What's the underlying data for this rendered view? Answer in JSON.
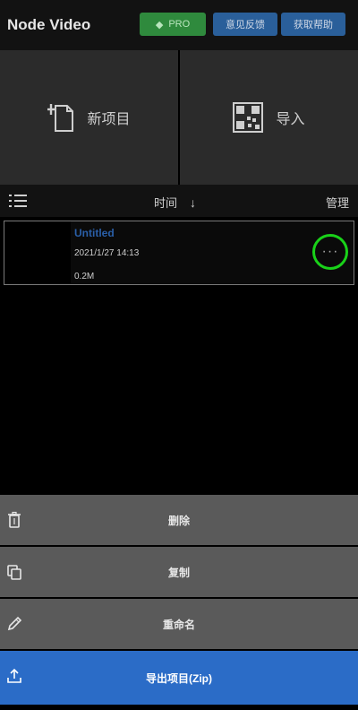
{
  "header": {
    "title": "Node Video",
    "pro_label": "PRO",
    "feedback_label": "意见反馈",
    "help_label": "获取帮助"
  },
  "actions": {
    "new_project_label": "新项目",
    "import_label": "导入"
  },
  "sortbar": {
    "sort_label": "时间",
    "manage_label": "管理"
  },
  "project": {
    "name": "Untitled",
    "date": "2021/1/27 14:13",
    "size": "0.2M",
    "more_label": "···"
  },
  "sheet": {
    "delete_label": "删除",
    "copy_label": "复制",
    "rename_label": "重命名",
    "export_label": "导出项目(Zip)"
  },
  "colors": {
    "pro": "#2f8a3d",
    "header_buttons": "#2a5f9a",
    "highlight_circle": "#19d219",
    "export": "#2b6cc7",
    "project_name": "#2a5fa8"
  }
}
